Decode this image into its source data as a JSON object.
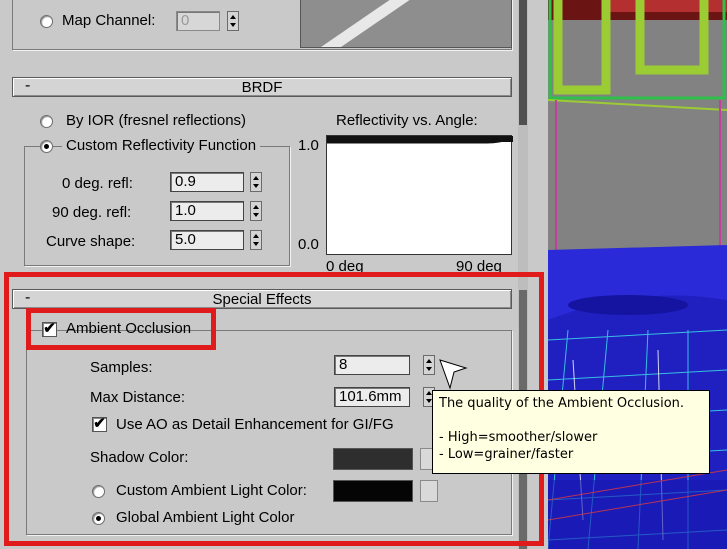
{
  "map_channel": {
    "label": "Map Channel:",
    "value": "0"
  },
  "brdf": {
    "title": "BRDF",
    "collapse": "-",
    "by_ior_label": "By IOR (fresnel reflections)",
    "custom_label": "Custom Reflectivity Function",
    "params": [
      {
        "label": "0 deg. refl:",
        "value": "0.9"
      },
      {
        "label": "90 deg. refl:",
        "value": "1.0"
      },
      {
        "label": "Curve shape:",
        "value": "5.0"
      }
    ],
    "graph": {
      "title": "Reflectivity vs. Angle:",
      "y_top": "1.0",
      "y_bottom": "0.0",
      "x_left": "0 deg",
      "x_right": "90 deg"
    }
  },
  "special_effects": {
    "title": "Special Effects",
    "collapse": "-",
    "ao_label": "Ambient Occlusion",
    "samples_label": "Samples:",
    "samples_value": "8",
    "max_distance_label": "Max Distance:",
    "max_distance_value": "101.6mm",
    "detail_label": "Use AO as Detail Enhancement for GI/FG",
    "shadow_color_label": "Shadow Color:",
    "shadow_color": "#2e2e2e",
    "custom_ambient_label": "Custom Ambient Light Color:",
    "custom_ambient_color": "#050505",
    "global_ambient_label": "Global Ambient Light Color"
  },
  "tooltip": {
    "line1": "The quality of the Ambient Occlusion.",
    "line2": "- High=smoother/slower",
    "line3": "- Low=grainer/faster"
  },
  "colors": {
    "highlight": "#e01b1b",
    "viewport_bg": "#7f7f7f"
  }
}
